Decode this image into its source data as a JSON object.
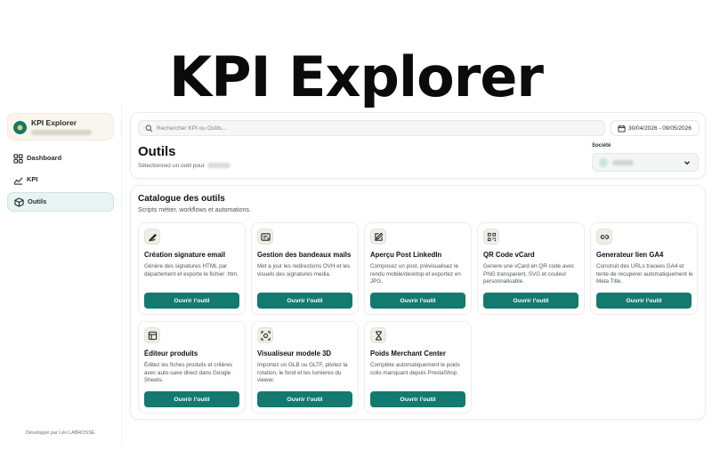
{
  "hero": {
    "title": "KPI Explorer"
  },
  "sidebar": {
    "brand": {
      "name": "KPI Explorer"
    },
    "items": [
      {
        "label": "Dashboard",
        "icon": "dashboard-icon"
      },
      {
        "label": "KPI",
        "icon": "chart-line-icon"
      },
      {
        "label": "Outils",
        "icon": "cube-icon",
        "active": true
      }
    ],
    "footer": "Développé par Léo LABROSSE"
  },
  "header": {
    "search_placeholder": "Rechercher KPI ou Outils...",
    "date_range": "30/04/2026 - 09/05/2026",
    "title": "Outils",
    "subtitle": "Sélectionnez un outil pour",
    "company_label": "Société"
  },
  "catalogue": {
    "title": "Catalogue des outils",
    "subtitle": "Scripts métier, workflows et automations.",
    "button_label": "Ouvrir l'outil",
    "tools": [
      {
        "title": "Création signature email",
        "icon": "signature-icon",
        "description": "Génère des signatures HTML par département et exporte le fichier .htm."
      },
      {
        "title": "Gestion des bandeaux mails",
        "icon": "banner-icon",
        "description": "Met a jour les redirections OVH et les visuels des signatures media."
      },
      {
        "title": "Aperçu Post LinkedIn",
        "icon": "edit-icon",
        "description": "Composez un post, prévisualisez le rendu mobile/desktop et exportez en JPG."
      },
      {
        "title": "QR Code vCard",
        "icon": "qr-code-icon",
        "description": "Genere une vCard en QR code avec PNG transparent, SVG et couleur personnalisable."
      },
      {
        "title": "Generateur lien GA4",
        "icon": "link-icon",
        "description": "Construit des URLs tracees GA4 et tente de recuperer automatiquement le Meta Title."
      },
      {
        "title": "Éditeur produits",
        "icon": "table-icon",
        "description": "Éditez les fiches produits et critères avec auto-save direct dans Google Sheets."
      },
      {
        "title": "Visualiseur modele 3D",
        "icon": "scan-3d-icon",
        "description": "Importez un GLB ou GLTF, pilotez la rotation, le fond et les lumieres du viewer."
      },
      {
        "title": "Poids Merchant Center",
        "icon": "hourglass-icon",
        "description": "Complète automatiquement le poids colis manquant depuis PrestaShop."
      }
    ]
  },
  "colors": {
    "accent": "#137a6f",
    "active_bg": "#e8f4f2",
    "brand_bg": "#faf6ee"
  }
}
